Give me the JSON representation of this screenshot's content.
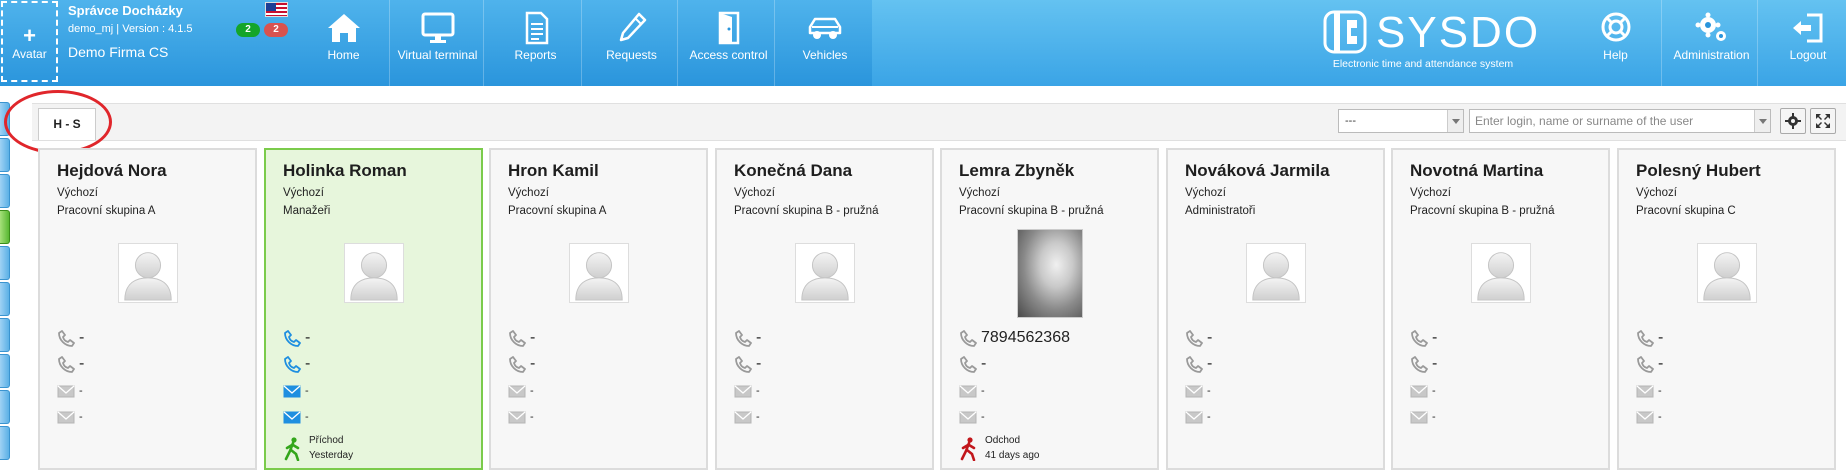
{
  "header": {
    "avatar_plus": "+",
    "avatar_label": "Avatar",
    "user_name": "Správce Docházky",
    "user_version": "demo_mj | Version : 4.1.5",
    "company": "Demo Firma CS",
    "badge_green": "2",
    "badge_red": "2",
    "nav": [
      {
        "label": "Home",
        "icon": "home-icon"
      },
      {
        "label": "Virtual terminal",
        "icon": "monitor-icon"
      },
      {
        "label": "Reports",
        "icon": "document-icon"
      },
      {
        "label": "Requests",
        "icon": "pencil-icon"
      },
      {
        "label": "Access control",
        "icon": "door-icon"
      },
      {
        "label": "Vehicles",
        "icon": "car-icon"
      }
    ],
    "logo_text": "SYSDO",
    "logo_sub": "Electronic time and attendance system",
    "right_nav": [
      {
        "label": "Help",
        "icon": "lifebuoy-icon"
      },
      {
        "label": "Administration",
        "icon": "gears-icon"
      },
      {
        "label": "Logout",
        "icon": "logout-icon"
      }
    ],
    "colors": {
      "header_blue": "#2a95dc",
      "badge_green": "#14a52a",
      "badge_red": "#d9534f"
    }
  },
  "toolbar": {
    "tab_label": "H - S",
    "select_value": "---",
    "search_placeholder": "Enter login, name or surname of the user"
  },
  "cards": [
    {
      "name": "Hejdová Nora",
      "default": "Výchozí",
      "group": "Pracovní skupina A",
      "phone1": "-",
      "phone2": "-",
      "email1": "-",
      "email2": "-"
    },
    {
      "name": "Holinka Roman",
      "default": "Výchozí",
      "group": "Manažeři",
      "phone1": "-",
      "phone2": "-",
      "email1": "-",
      "email2": "-",
      "status_line1": "Příchod",
      "status_line2": "Yesterday"
    },
    {
      "name": "Hron Kamil",
      "default": "Výchozí",
      "group": "Pracovní skupina A",
      "phone1": "-",
      "phone2": "-",
      "email1": "-",
      "email2": "-"
    },
    {
      "name": "Konečná Dana",
      "default": "Výchozí",
      "group": "Pracovní skupina B - pružná",
      "phone1": "-",
      "phone2": "-",
      "email1": "-",
      "email2": "-"
    },
    {
      "name": "Lemra Zbyněk",
      "default": "Výchozí",
      "group": "Pracovní skupina B - pružná",
      "phone1": "7894562368",
      "phone2": "-",
      "email1": "-",
      "email2": "-",
      "status_line1": "Odchod",
      "status_line2": "41 days ago"
    },
    {
      "name": "Nováková Jarmila",
      "default": "Výchozí",
      "group": "Administratoři",
      "phone1": "-",
      "phone2": "-",
      "email1": "-",
      "email2": "-"
    },
    {
      "name": "Novotná Martina",
      "default": "Výchozí",
      "group": "Pracovní skupina B - pružná",
      "phone1": "-",
      "phone2": "-",
      "email1": "-",
      "email2": "-"
    },
    {
      "name": "Polesný Hubert",
      "default": "Výchozí",
      "group": "Pracovní skupina C",
      "phone1": "-",
      "phone2": "-",
      "email1": "-",
      "email2": "-"
    }
  ]
}
